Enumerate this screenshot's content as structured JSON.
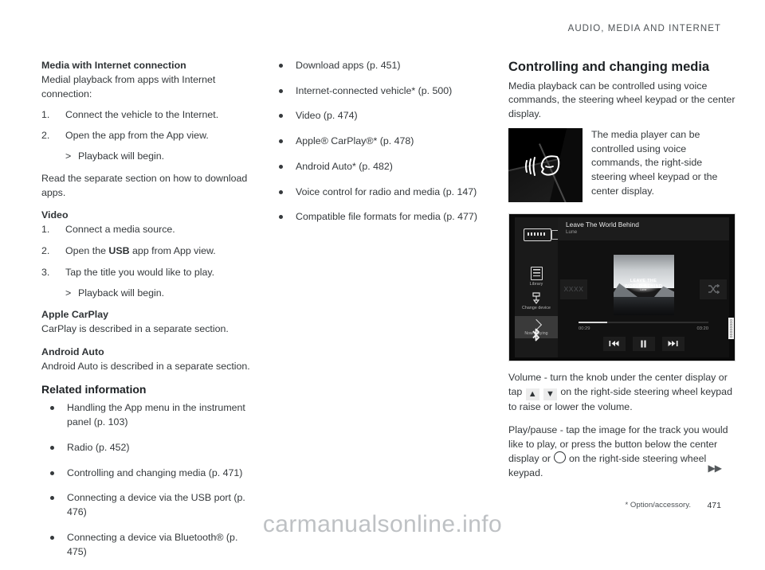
{
  "header": {
    "title": "AUDIO, MEDIA AND INTERNET"
  },
  "col1": {
    "s1_heading": "Media with Internet connection",
    "s1_intro": "Medial playback from apps with Internet connection:",
    "s1_steps": [
      {
        "num": "1.",
        "text": "Connect the vehicle to the Internet."
      },
      {
        "num": "2.",
        "text": "Open the app from the App view."
      }
    ],
    "s1_result": "Playback will begin.",
    "s1_result_marker": ">",
    "s1_after": "Read the separate section on how to download apps.",
    "s2_heading": "Video",
    "s2_steps": [
      {
        "num": "1.",
        "text": "Connect a media source."
      },
      {
        "num": "2.",
        "pre": "Open the ",
        "bold": "USB",
        "post": " app from App view."
      },
      {
        "num": "3.",
        "text": "Tap the title you would like to play."
      }
    ],
    "s2_result": "Playback will begin.",
    "s3_heading": "Apple CarPlay",
    "s3_body": "CarPlay is described in a separate section.",
    "s4_heading": "Android Auto",
    "s4_body": "Android Auto is described in a separate section.",
    "related_heading": "Related information",
    "related": [
      "Handling the App menu in the instrument panel (p. 103)",
      "Radio (p. 452)",
      "Controlling and changing media (p. 471)",
      "Connecting a device via the USB port (p. 476)",
      "Connecting a device via Bluetooth® (p. 475)"
    ]
  },
  "col2": {
    "related_continued": [
      "Download apps (p. 451)",
      "Internet-connected vehicle* (p. 500)",
      "Video (p. 474)",
      "Apple® CarPlay®* (p. 478)",
      "Android Auto* (p. 482)",
      "Voice control for radio and media (p. 147)",
      "Compatible file formats for media (p. 477)"
    ]
  },
  "col3": {
    "heading": "Controlling and changing media",
    "intro": "Media playback can be controlled using voice commands, the steering wheel keypad or the center display.",
    "voice_caption": "The media player can be controlled using voice commands, the right-side steering wheel keypad or the center display.",
    "volume_pre": "Volume - turn the knob under the center display or tap",
    "volume_up_key": "▲",
    "volume_down_key": "▼",
    "volume_post": "on the right-side steering wheel keypad to raise or lower the volume.",
    "playpause_pre": "Play/pause - tap the image for the track you would like to play, or press the button below the center display or",
    "playpause_post": "on the right-side steering wheel keypad."
  },
  "player": {
    "track_title": "Leave The World Behind",
    "track_artist": "Lune",
    "album_line1": "LEAVE THE",
    "album_line2": "WORLD BEHIND",
    "album_artist": "Lune",
    "sidebar": [
      {
        "label": "Library",
        "icon": "library-icon"
      },
      {
        "label": "Change device",
        "icon": "change-device-icon"
      },
      {
        "label": "Now playing",
        "icon": "now-playing-icon"
      }
    ],
    "bluetooth_icon": "bluetooth-icon",
    "repeat_label": "XXXX",
    "shuffle_icon": "shuffle-icon",
    "time_elapsed": "00:29",
    "time_total": "03:20",
    "prev_icon": "previous-track-icon",
    "pause_icon": "pause-icon",
    "next_icon": "next-track-icon",
    "image_code": "00000000"
  },
  "footer": {
    "arrows": "▶▶",
    "footnote": "* Option/accessory.",
    "page_number": "471",
    "watermark": "carmanualsonline.info"
  }
}
